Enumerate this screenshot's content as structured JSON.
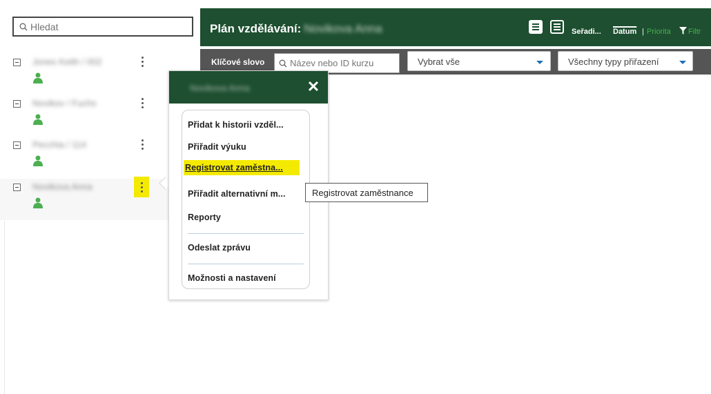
{
  "search": {
    "placeholder": "Hledat"
  },
  "tree": {
    "items": [
      {
        "name": "Jones Keith / 002"
      },
      {
        "name": "Novikov / Fuchs"
      },
      {
        "name": "Pecchia / 114"
      },
      {
        "name": "Novikova Anna"
      }
    ]
  },
  "header": {
    "title": "Plán vzdělávání:",
    "title_name": "Novikova Anna",
    "sort_label": "Seřadi...",
    "sort_date": "Datum",
    "sort_separator": "|",
    "sort_priority": "Priorita",
    "filter_label": "Filtr"
  },
  "filterbar": {
    "keyword_label": "Klíčové slovo",
    "keyword_placeholder": "Název nebo ID kurzu",
    "select_all": "Vybrat vše",
    "assignment_types": "Všechny typy přiřazení"
  },
  "popup": {
    "name": "Novikova Anna",
    "close": "✕",
    "items": [
      "Přidat k historii vzděl...",
      "Přiřadit výuku",
      "Registrovat zaměstna...",
      "Přiřadit alternativní m...",
      "Reporty",
      "Odeslat zprávu",
      "Možnosti a nastavení"
    ]
  },
  "tooltip": {
    "text": "Registrovat zaměstnance"
  },
  "colors": {
    "brand_green": "#1d4f30",
    "filterbar": "#555555",
    "highlight": "#f4ea00",
    "priority_green": "#4caf50",
    "caret_blue": "#1f6fb5"
  }
}
